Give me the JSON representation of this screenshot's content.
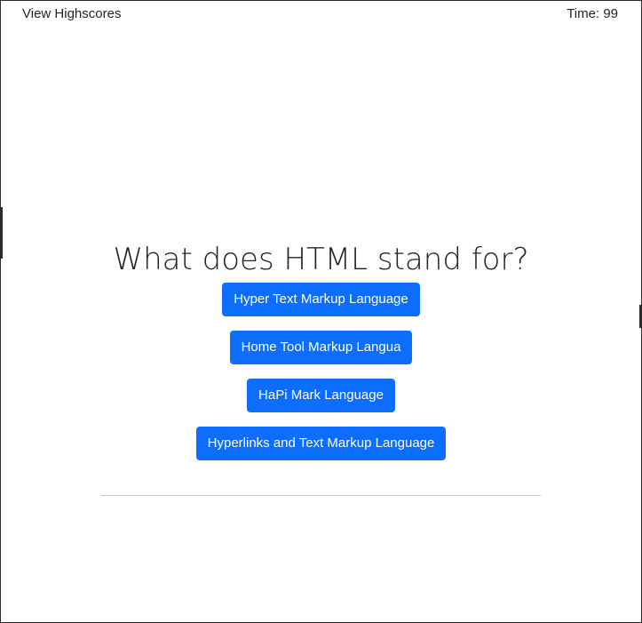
{
  "header": {
    "highscores_link": "View Highscores",
    "timer": "Time: 99"
  },
  "quiz": {
    "question": "What does HTML stand for?",
    "answers": [
      "Hyper Text Markup Language",
      "Home Tool Markup Langua",
      "HaPi Mark Language",
      "Hyperlinks and Text Markup Language"
    ]
  },
  "colors": {
    "button_bg": "#0d6efd",
    "button_text": "#ffffff",
    "text": "#212529",
    "divider": "#c8c8c8"
  }
}
